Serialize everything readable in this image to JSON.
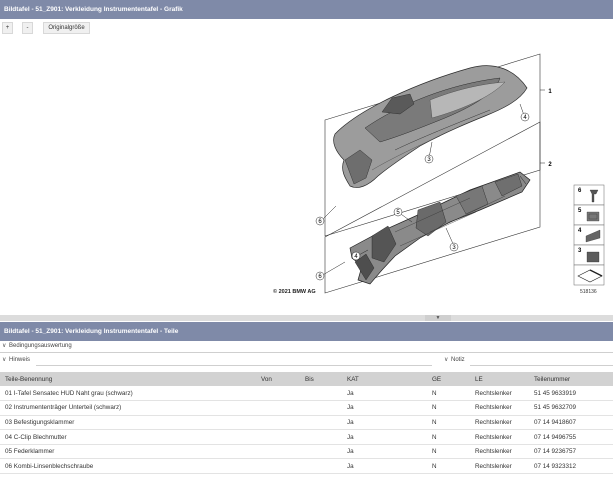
{
  "graphic_panel": {
    "title": "Bildtafel - 51_Z901: Verkleidung Instrumententafel - Grafik",
    "toolbar": {
      "zoom_in": "+",
      "zoom_out": "-",
      "original_size": "Originalgröße"
    },
    "copyright": "© 2021 BMW AG",
    "image_number": "518136",
    "callouts": [
      "1",
      "2",
      "3",
      "3",
      "4",
      "4",
      "5",
      "6",
      "6"
    ],
    "legend_numbers": [
      "6",
      "5",
      "4",
      "3"
    ]
  },
  "parts_panel": {
    "title": "Bildtafel - 51_Z901: Verkleidung Instrumententafel - Teile",
    "condition_evaluation": "Bedingungsauswertung",
    "hint": "Hinweis",
    "note": "Notiz",
    "columns": [
      "Teile-Benennung",
      "Von",
      "Bis",
      "KAT",
      "GE",
      "LE",
      "Teilenummer"
    ],
    "rows": [
      [
        "01 I-Tafel Sensatec HUD Naht grau (schwarz)",
        "",
        "",
        "Ja",
        "N",
        "Rechtslenker",
        "51 45 9633919"
      ],
      [
        "02 Instrumententräger Unterteil (schwarz)",
        "",
        "",
        "Ja",
        "N",
        "Rechtslenker",
        "51 45 9632709"
      ],
      [
        "03 Befestigungsklammer",
        "",
        "",
        "Ja",
        "N",
        "Rechtslenker",
        "07 14 9418607"
      ],
      [
        "04 C-Clip Blechmutter",
        "",
        "",
        "Ja",
        "N",
        "Rechtslenker",
        "07 14 9496755"
      ],
      [
        "05 Federklammer",
        "",
        "",
        "Ja",
        "N",
        "Rechtslenker",
        "07 14 9236757"
      ],
      [
        "06 Kombi-Linsenblechschraube",
        "",
        "",
        "Ja",
        "N",
        "Rechtslenker",
        "07 14 9323312"
      ]
    ]
  },
  "colors": {
    "title_bar": "#7f8aa8",
    "table_header": "#d2d2d2",
    "splitter": "#dcdcdc"
  }
}
